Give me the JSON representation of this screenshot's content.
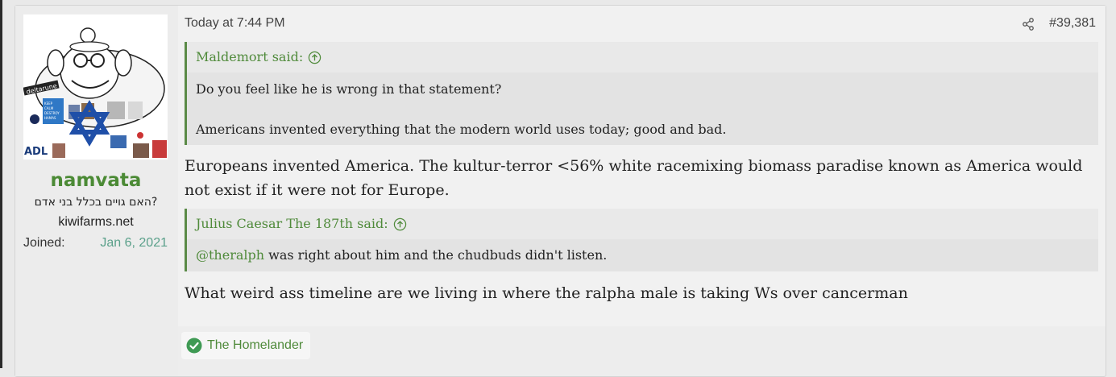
{
  "user": {
    "name": "namvata",
    "title": "האם גויים בכלל בני אדם?",
    "site": "kiwifarms.net",
    "joined_label": "Joined:",
    "joined_value": "Jan 6, 2021",
    "avatar_text": {
      "deltarune": "deltarune",
      "keep_calm": "KEEP CALM AND DESTROY HAMAS",
      "adl": "ADL"
    }
  },
  "post": {
    "date": "Today at 7:44 PM",
    "number": "#39,381",
    "quote1": {
      "author": "Maldemort said:",
      "line1": "Do you feel like he is wrong in that statement?",
      "line2": "Americans invented everything that the modern world uses today; good and bad."
    },
    "reply1": "Europeans invented America. The kultur-terror <56% white racemixing biomass paradise known as America would not exist if it were not for Europe.",
    "quote2": {
      "author": "Julius Caesar The 187th said:",
      "mention": "@theralph",
      "text": " was right about him and the chudbuds didn't listen."
    },
    "reply2": "What weird ass timeline are we living in where the ralpha male is taking Ws over cancerman"
  },
  "reactions": {
    "name": "The Homelander",
    "icon": "check-circle-icon",
    "color": "#3f9a54"
  },
  "colors": {
    "accent_green": "#4f8a3a",
    "joined_date": "#5aa08a",
    "quote_border": "#5a8a46"
  }
}
